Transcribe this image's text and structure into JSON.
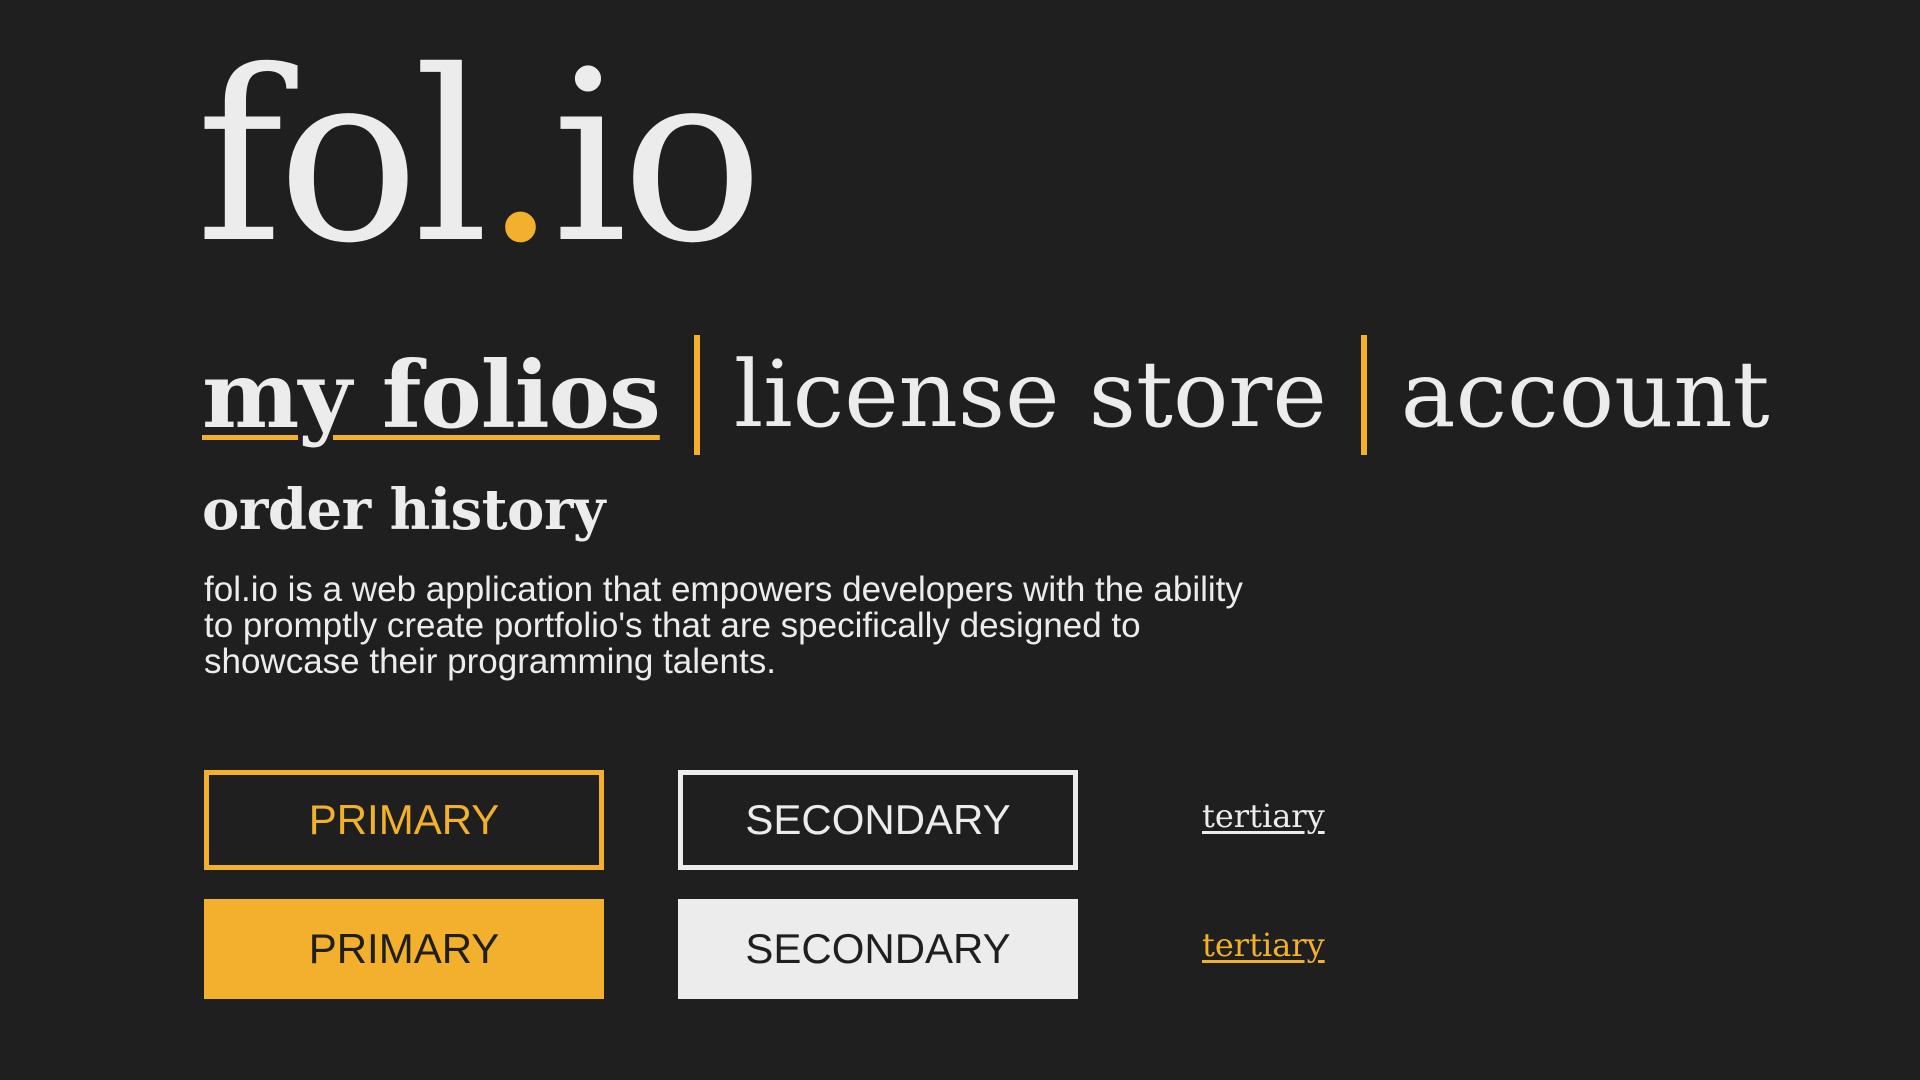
{
  "brand": {
    "name_part1": "fol",
    "dot": ".",
    "name_part2": "io"
  },
  "nav": {
    "items": [
      {
        "label": "my folios",
        "active": true
      },
      {
        "label": "license store",
        "active": false
      },
      {
        "label": "account",
        "active": false
      }
    ],
    "separator": "|"
  },
  "section": {
    "title": "order history"
  },
  "description": {
    "text": "fol.io is a web application that empowers developers with the ability to promptly create portfolio's that are specifically designed to showcase their programming talents."
  },
  "buttons": {
    "primary_outline": "PRIMARY",
    "secondary_outline": "SECONDARY",
    "tertiary_light": "tertiary",
    "primary_filled": "PRIMARY",
    "secondary_filled": "SECONDARY",
    "tertiary_accent": "tertiary"
  },
  "colors": {
    "background": "#1f1f1f",
    "text": "#ececec",
    "accent": "#f2b02d"
  }
}
